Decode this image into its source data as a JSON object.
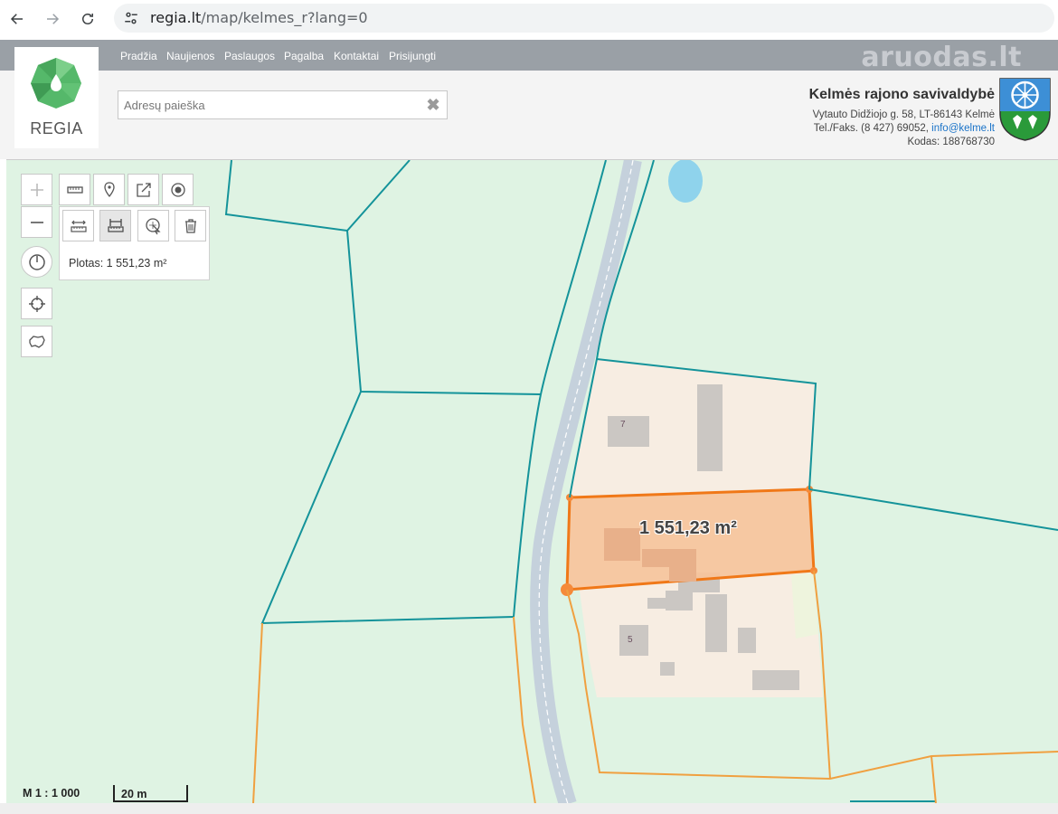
{
  "browser": {
    "url_host": "regia.lt",
    "url_path": "/map/kelmes_r?lang=0"
  },
  "topnav": {
    "items": [
      "Pradžia",
      "Naujienos",
      "Paslaugos",
      "Pagalba",
      "Kontaktai",
      "Prisijungti"
    ]
  },
  "watermark": "aruodas.lt",
  "logo": {
    "text": "REGIA"
  },
  "search": {
    "placeholder": "Adresų paieška",
    "clear": "✖"
  },
  "municipality": {
    "name": "Kelmės rajono savivaldybė",
    "address": "Vytauto Didžiojo g. 58, LT-86143 Kelmė",
    "phone_prefix": "Tel./Faks. (8 427) 69052, ",
    "email": "info@kelme.lt",
    "code": "Kodas: 188768730"
  },
  "map": {
    "measure_result": "Plotas: 1 551,23 m²",
    "area_label": "1 551,23 m²",
    "house_numbers": [
      "7",
      "5"
    ],
    "scale_ratio": "M 1 : 1 000",
    "scale_bar": "20 m"
  },
  "controls": {
    "zoom_in": "plus-icon",
    "zoom_out": "minus-icon",
    "history": "clock-icon",
    "locate": "crosshair-icon",
    "extent": "lithuania-outline-icon",
    "tools": [
      "ruler-icon",
      "marker-icon",
      "share-icon",
      "radio-target-icon"
    ],
    "measure_tools": [
      "measure-distance-icon",
      "measure-area-icon",
      "select-object-icon",
      "trash-icon"
    ]
  },
  "colors": {
    "parcel_border": "#14939a",
    "parcel_border_orange": "#f0a040",
    "measure_fill": "#f8c39a",
    "measure_stroke": "#f07818",
    "meadow": "#dff3e3",
    "yard": "#f7ede2",
    "building": "#cbc7c3",
    "road": "#c5d1dc"
  }
}
